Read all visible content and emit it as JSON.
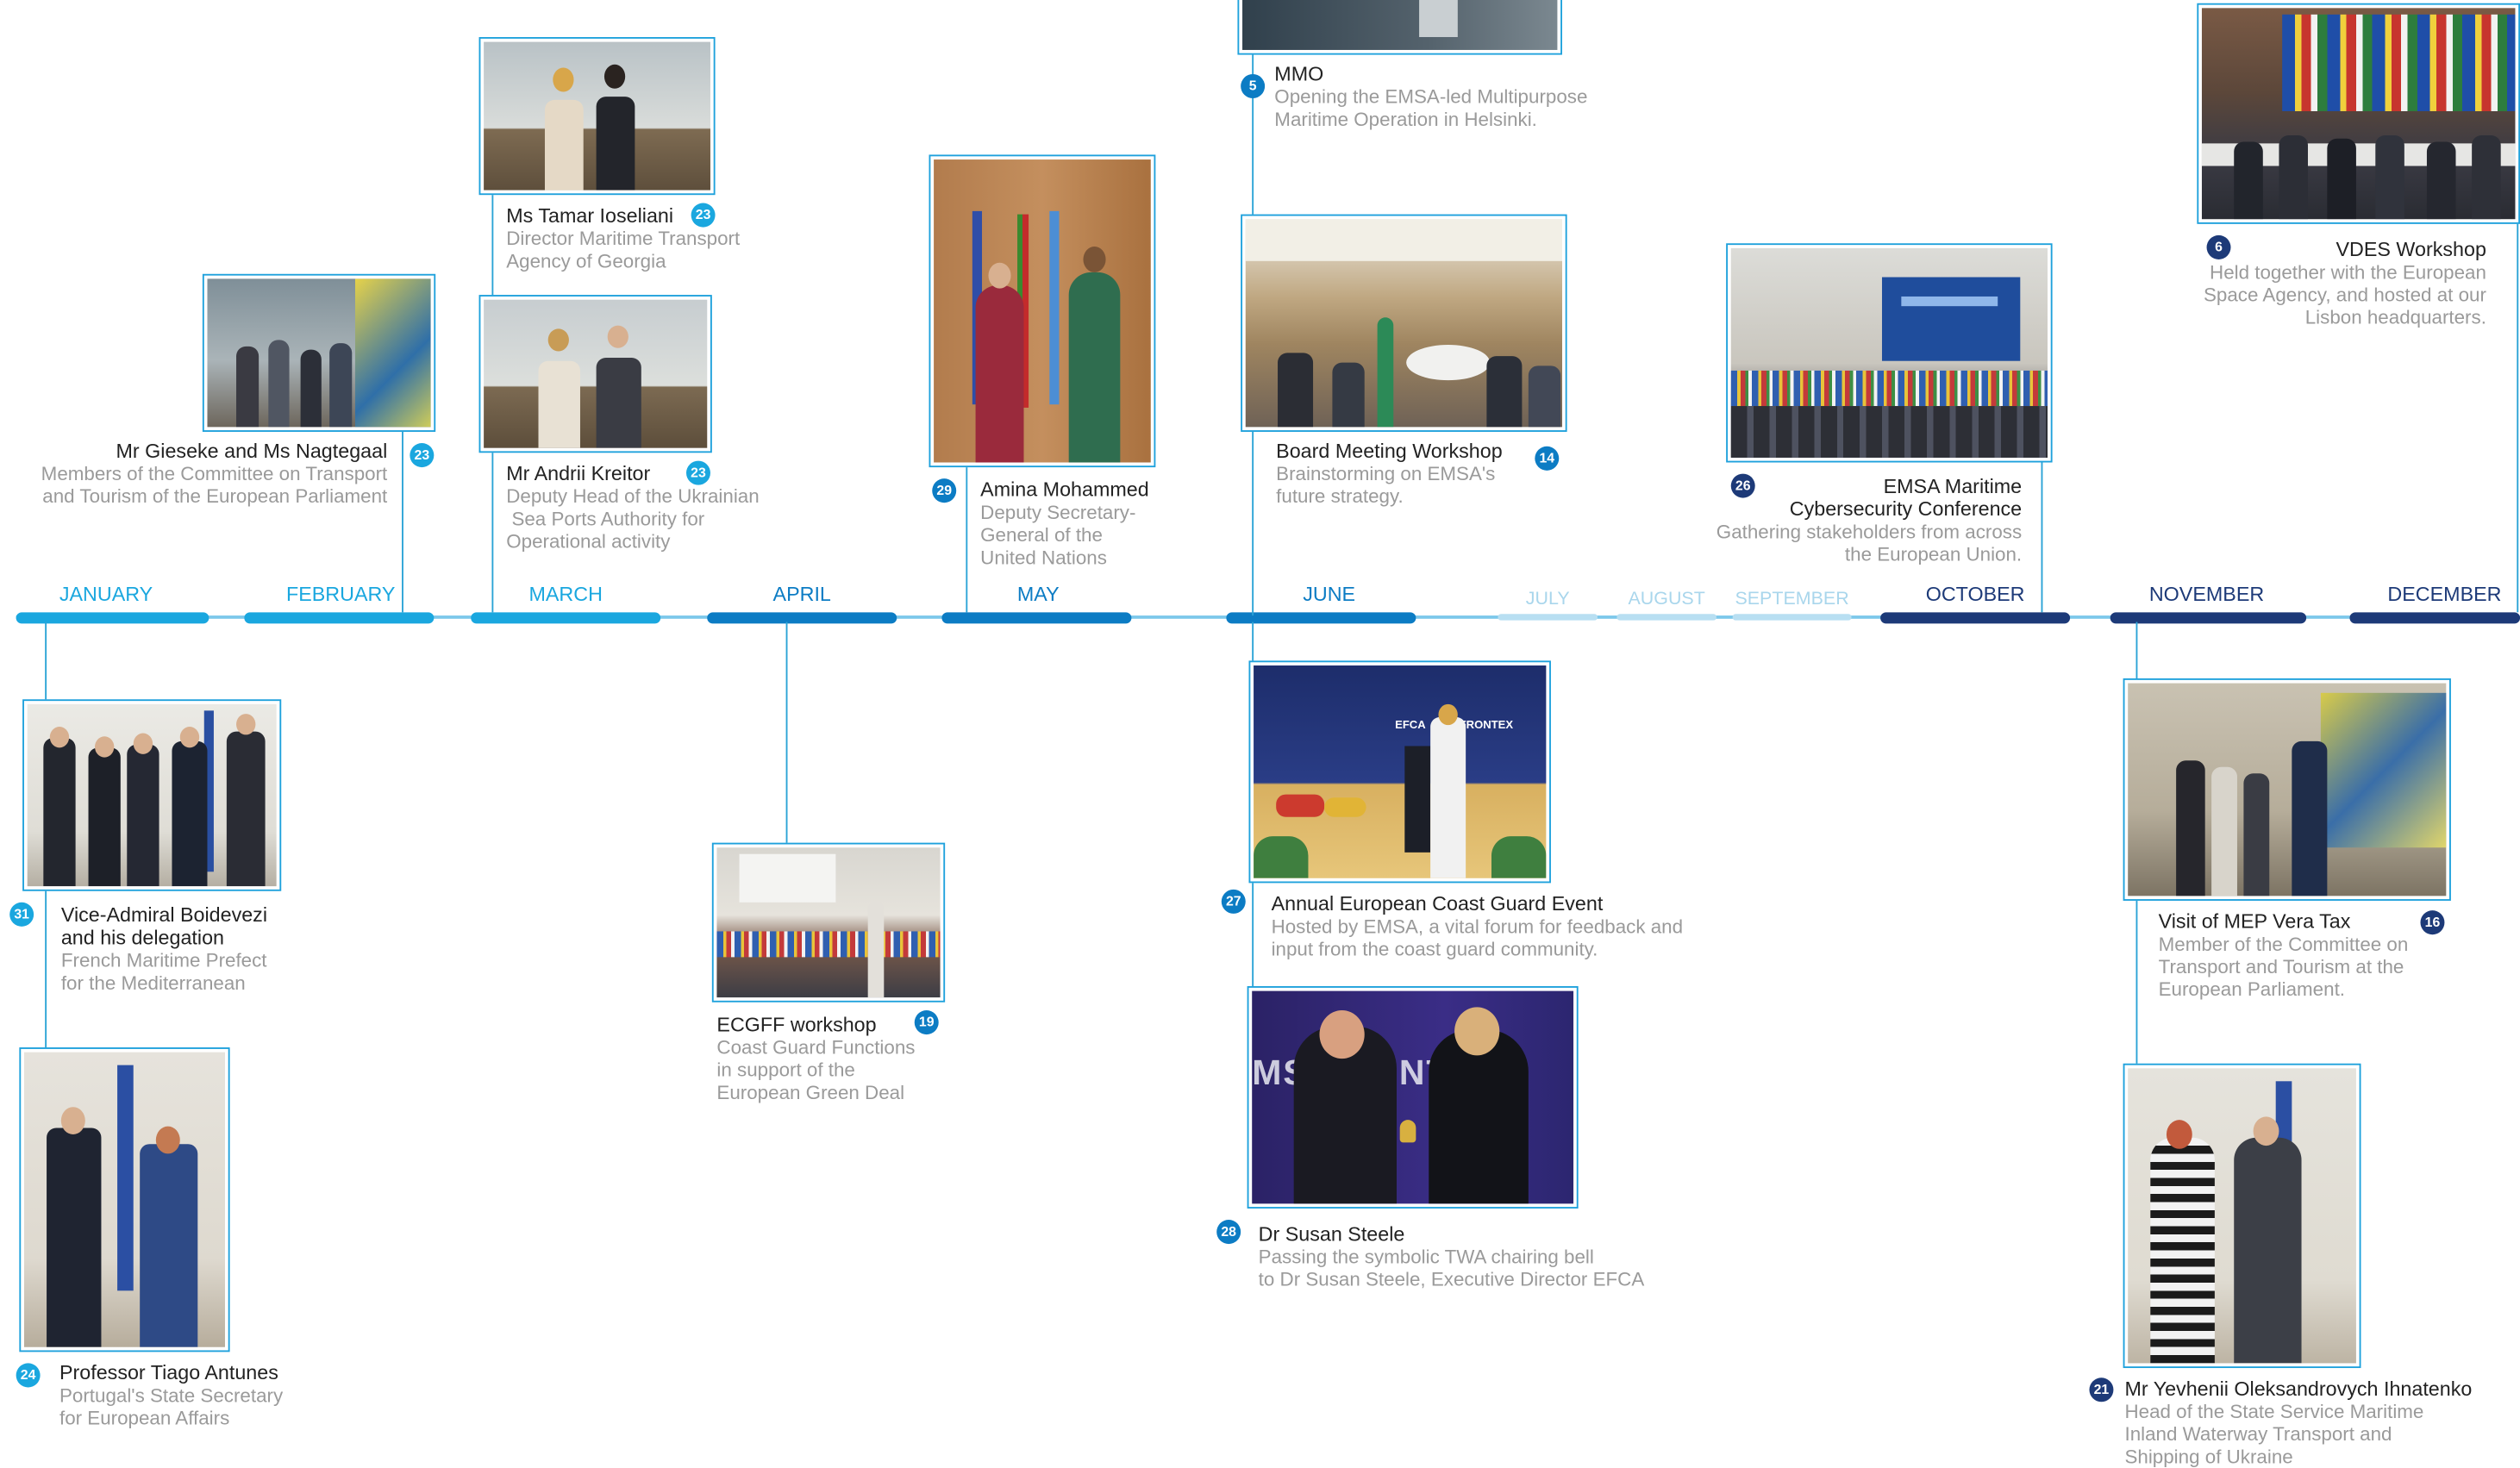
{
  "timeline": {
    "months": [
      {
        "label": "JANUARY",
        "color": "#1aa7df"
      },
      {
        "label": "FEBRUARY",
        "color": "#1aa7df"
      },
      {
        "label": "MARCH",
        "color": "#1aa7df"
      },
      {
        "label": "APRIL",
        "color": "#0c7cc4"
      },
      {
        "label": "MAY",
        "color": "#0c7cc4"
      },
      {
        "label": "JUNE",
        "color": "#0c7cc4"
      },
      {
        "label": "JULY",
        "color": "#b8dff2"
      },
      {
        "label": "AUGUST",
        "color": "#b8dff2"
      },
      {
        "label": "SEPTEMBER",
        "color": "#b8dff2"
      },
      {
        "label": "OCTOBER",
        "color": "#1d3a78"
      },
      {
        "label": "NOVEMBER",
        "color": "#1d3a78"
      },
      {
        "label": "DECEMBER",
        "color": "#1d3a78"
      }
    ]
  },
  "events": [
    {
      "day": "23",
      "name": "Mr Gieseke and Ms Nagtegaal",
      "description": "Members of the Committee on Transport\n and Tourism of the European Parliament"
    },
    {
      "day": "23",
      "name": "Ms Tamar Ioseliani",
      "description": "Director Maritime Transport\nAgency of Georgia"
    },
    {
      "day": "23",
      "name": "Mr Andrii Kreitor",
      "description": "Deputy Head of the Ukrainian\n Sea Ports Authority for\nOperational activity"
    },
    {
      "day": "29",
      "name": "Amina Mohammed",
      "description": "Deputy Secretary-\nGeneral of the\nUnited Nations"
    },
    {
      "day": "5",
      "name": "MMO",
      "description": "Opening the EMSA-led Multipurpose\nMaritime Operation in Helsinki."
    },
    {
      "day": "14",
      "name": "Board Meeting Workshop",
      "description": "Brainstorming on EMSA's\nfuture strategy."
    },
    {
      "day": "26",
      "name": "EMSA Maritime\nCybersecurity Conference",
      "description": "Gathering stakeholders from across\nthe European Union."
    },
    {
      "day": "6",
      "name": "VDES Workshop",
      "description": "Held together with the European\nSpace Agency, and hosted at our\nLisbon headquarters."
    },
    {
      "day": "31",
      "name": "Vice-Admiral Boidevezi\nand his delegation",
      "description": "French Maritime Prefect\nfor the Mediterranean"
    },
    {
      "day": "24",
      "name": "Professor Tiago Antunes",
      "description": "Portugal's State Secretary\nfor European Affairs"
    },
    {
      "day": "19",
      "name": "ECGFF workshop",
      "description": "Coast Guard Functions\nin support of the\nEuropean Green Deal"
    },
    {
      "day": "27",
      "name": "Annual European Coast Guard Event",
      "description": "Hosted by EMSA, a vital forum for feedback and\ninput from the coast guard community."
    },
    {
      "day": "28",
      "name": "Dr Susan Steele",
      "description": "Passing the symbolic TWA chairing bell\nto Dr Susan Steele, Executive Director EFCA"
    },
    {
      "day": "16",
      "name": "Visit of MEP Vera Tax",
      "description": "Member of the Committee on\nTransport and Tourism at the\nEuropean Parliament."
    },
    {
      "day": "21",
      "name": "Mr Yevhenii Oleksandrovych Ihnatenko",
      "description": "Head of the State Service Maritime\nInland Waterway Transport and\nShipping of Ukraine"
    }
  ],
  "photo_texts": {
    "efca_banner": "EFCA",
    "frontex_banner": "FRONTEX",
    "stage_banner": "MS FRONTEX"
  },
  "colors": {
    "light_blue": "#1aa7df",
    "mid_blue": "#0c7cc4",
    "navy": "#1d3a78",
    "pale_blue": "#b8dff2",
    "photo_border": "#1ea1dc"
  }
}
